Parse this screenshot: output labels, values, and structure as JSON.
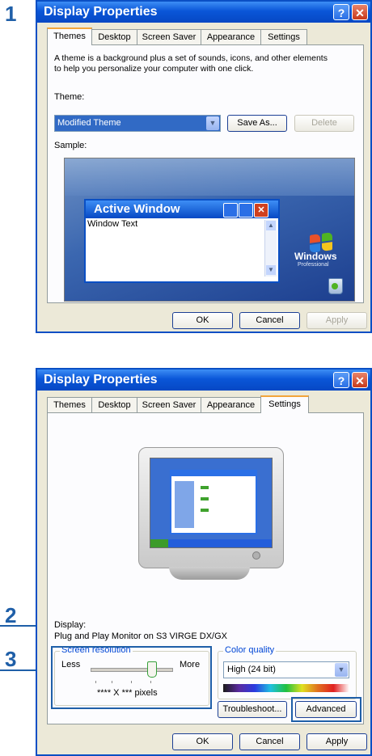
{
  "steps": [
    "1",
    "2",
    "3"
  ],
  "window1": {
    "title": "Display Properties",
    "help_glyph": "?",
    "close_glyph": "✕",
    "tabs": [
      "Themes",
      "Desktop",
      "Screen Saver",
      "Appearance",
      "Settings"
    ],
    "description_line1": "A theme is a background plus a set of sounds, icons, and other elements",
    "description_line2": "to help you personalize your computer with one click.",
    "theme_label": "Theme:",
    "theme_value": "Modified Theme",
    "save_as_label": "Save As...",
    "delete_label": "Delete",
    "sample_label": "Sample:",
    "sample": {
      "window_title": "Active Window",
      "window_text": "Window Text",
      "logo_text": "Windows",
      "logo_sub": "Professional"
    },
    "ok_label": "OK",
    "cancel_label": "Cancel",
    "apply_label": "Apply"
  },
  "window2": {
    "title": "Display Properties",
    "help_glyph": "?",
    "close_glyph": "✕",
    "tabs": [
      "Themes",
      "Desktop",
      "Screen Saver",
      "Appearance",
      "Settings"
    ],
    "display_label": "Display:",
    "display_value": "Plug and Play Monitor on S3 VIRGE DX/GX",
    "screen_resolution": {
      "legend": "Screen resolution",
      "less_label": "Less",
      "more_label": "More",
      "pixels_text": "**** X *** pixels",
      "slider_level": 0.75
    },
    "color_quality": {
      "legend": "Color quality",
      "value": "High (24 bit)"
    },
    "troubleshoot_label": "Troubleshoot...",
    "advanced_label": "Advanced",
    "ok_label": "OK",
    "cancel_label": "Cancel",
    "apply_label": "Apply"
  },
  "colors": {
    "title_bar": "#0a56d8",
    "annotation": "#1f5fa8",
    "active_tab_accent": "#f2a53b"
  }
}
